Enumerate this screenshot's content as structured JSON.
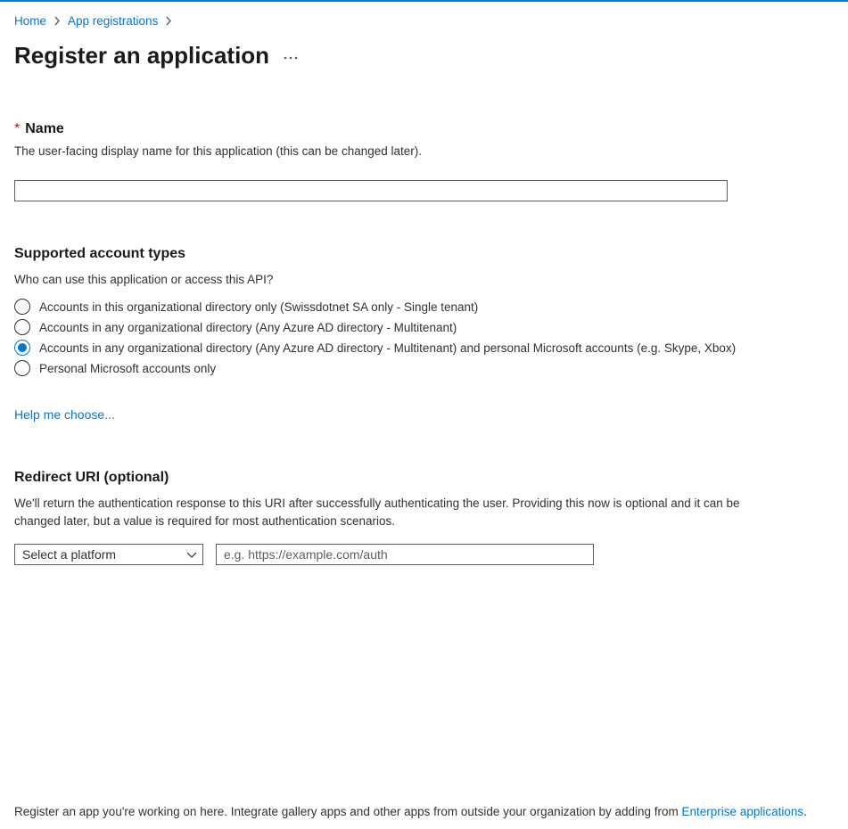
{
  "breadcrumb": {
    "home": "Home",
    "app_registrations": "App registrations"
  },
  "title": "Register an application",
  "name_section": {
    "label": "Name",
    "description": "The user-facing display name for this application (this can be changed later).",
    "value": ""
  },
  "accounts_section": {
    "heading": "Supported account types",
    "question": "Who can use this application or access this API?",
    "options": [
      "Accounts in this organizational directory only (Swissdotnet SA only - Single tenant)",
      "Accounts in any organizational directory (Any Azure AD directory - Multitenant)",
      "Accounts in any organizational directory (Any Azure AD directory - Multitenant) and personal Microsoft accounts (e.g. Skype, Xbox)",
      "Personal Microsoft accounts only"
    ],
    "selected_index": 2,
    "help_link": "Help me choose..."
  },
  "redirect_section": {
    "heading": "Redirect URI (optional)",
    "description": "We'll return the authentication response to this URI after successfully authenticating the user. Providing this now is optional and it can be changed later, but a value is required for most authentication scenarios.",
    "platform_placeholder": "Select a platform",
    "uri_placeholder": "e.g. https://example.com/auth",
    "uri_value": ""
  },
  "footer": {
    "text": "Register an app you're working on here. Integrate gallery apps and other apps from outside your organization by adding from ",
    "link_text": "Enterprise applications",
    "suffix": "."
  }
}
